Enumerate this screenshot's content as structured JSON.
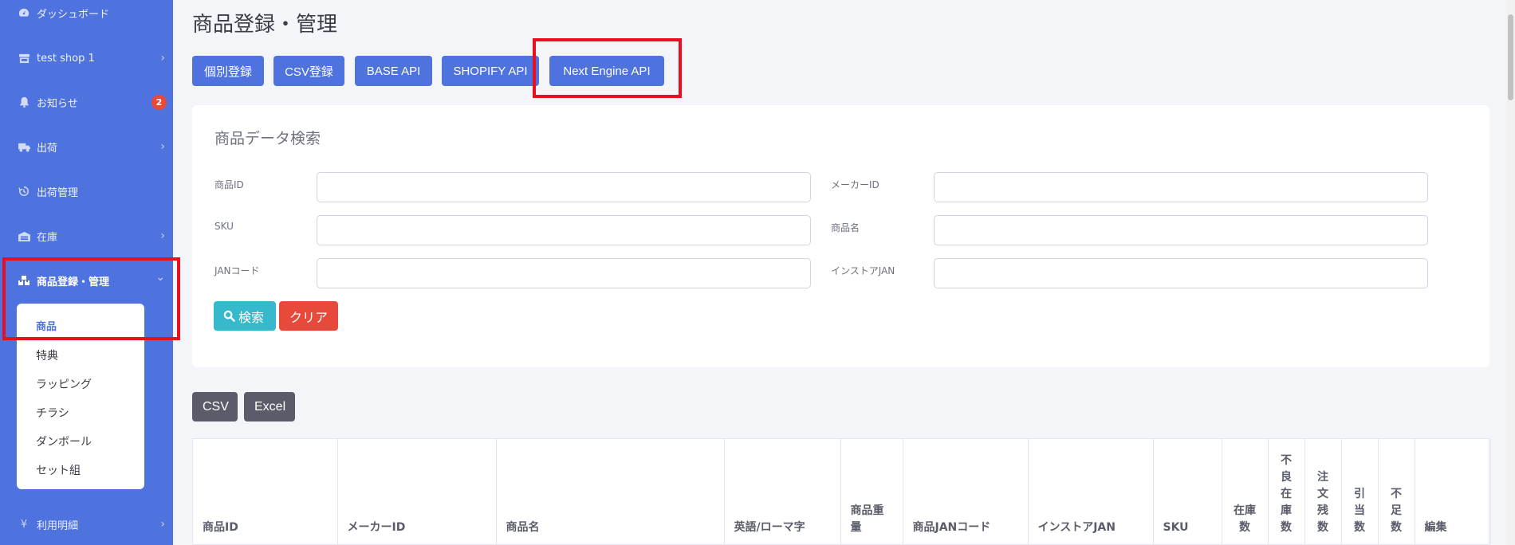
{
  "sidebar": {
    "items": [
      {
        "label": "ダッシュボード",
        "icon": "dashboard-icon",
        "chevron": false
      },
      {
        "label": "test shop 1",
        "icon": "store-icon",
        "chevron": true
      },
      {
        "label": "お知らせ",
        "icon": "bell-icon",
        "chevron": false,
        "badge": "2"
      },
      {
        "label": "出荷",
        "icon": "truck-icon",
        "chevron": true
      },
      {
        "label": "出荷管理",
        "icon": "history-icon",
        "chevron": false
      },
      {
        "label": "在庫",
        "icon": "warehouse-icon",
        "chevron": true
      },
      {
        "label": "商品登録・管理",
        "icon": "boxes-icon",
        "chevron": "down",
        "active": true
      },
      {
        "label": "利用明細",
        "icon": "yen-icon",
        "chevron": true
      }
    ],
    "submenu": [
      "商品",
      "特典",
      "ラッピング",
      "チラシ",
      "ダンボール",
      "セット組"
    ],
    "chevron_right": "›",
    "chevron_down": "⌄"
  },
  "page": {
    "title": "商品登録・管理"
  },
  "top_buttons": [
    "個別登録",
    "CSV登録",
    "BASE API",
    "SHOPIFY API",
    "Next Engine API"
  ],
  "search": {
    "title": "商品データ検索",
    "fields": [
      {
        "label": "商品ID",
        "value": ""
      },
      {
        "label": "メーカーID",
        "value": ""
      },
      {
        "label": "SKU",
        "value": ""
      },
      {
        "label": "商品名",
        "value": ""
      },
      {
        "label": "JANコード",
        "value": ""
      },
      {
        "label": "インストアJAN",
        "value": ""
      }
    ],
    "search_button": "検索",
    "clear_button": "クリア"
  },
  "export": {
    "csv": "CSV",
    "excel": "Excel"
  },
  "table": {
    "headers": [
      "商品ID",
      "メーカーID",
      "商品名",
      "英語/ローマ字",
      "商品重量",
      "商品JANコード",
      "インストアJAN",
      "SKU",
      "在庫数",
      "不良在庫数",
      "注文残数",
      "引当数",
      "不足数",
      "編集"
    ]
  },
  "colors": {
    "sidebar": "#4e73df",
    "primary": "#4e73df",
    "info": "#36b9cc",
    "danger": "#e74a3b",
    "secondary": "#5a5c69",
    "highlight": "#e8101f"
  }
}
